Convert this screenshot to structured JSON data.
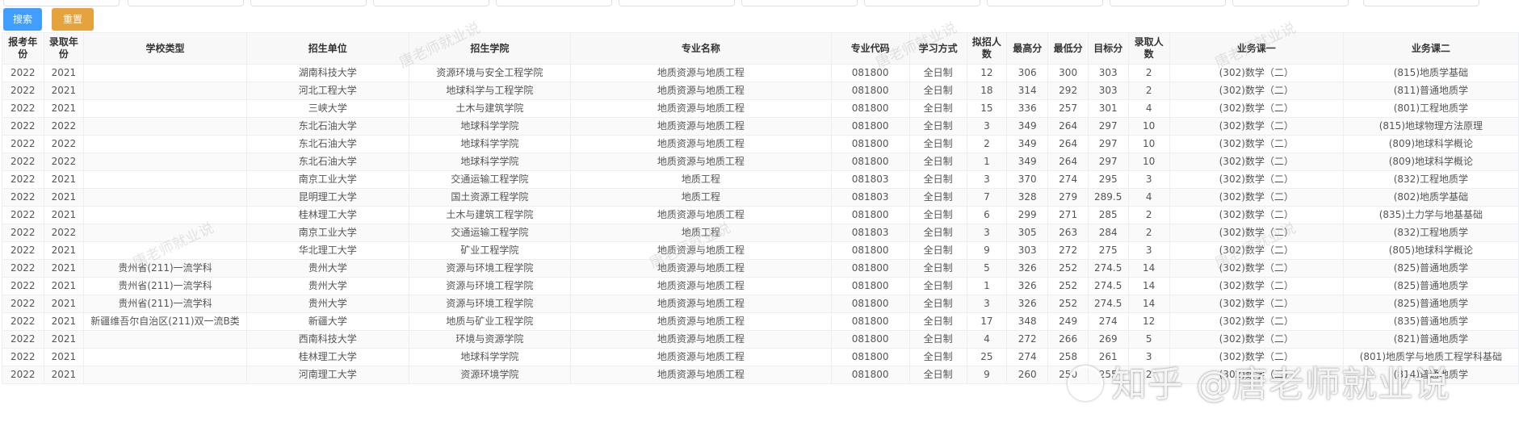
{
  "buttons": {
    "search": "搜索",
    "reset": "重置"
  },
  "columns": [
    "报考年份",
    "录取年份",
    "学校类型",
    "招生单位",
    "招生学院",
    "专业名称",
    "专业代码",
    "学习方式",
    "拟招人数",
    "最高分",
    "最低分",
    "目标分",
    "录取人数",
    "业务课一",
    "业务课二"
  ],
  "rows": [
    [
      "2022",
      "2021",
      "",
      "湖南科技大学",
      "资源环境与安全工程学院",
      "地质资源与地质工程",
      "081800",
      "全日制",
      "12",
      "306",
      "300",
      "303",
      "2",
      "(302)数学（二）",
      "(815)地质学基础"
    ],
    [
      "2022",
      "2021",
      "",
      "河北工程大学",
      "地球科学与工程学院",
      "地质资源与地质工程",
      "081800",
      "全日制",
      "18",
      "314",
      "292",
      "303",
      "2",
      "(302)数学（二）",
      "(811)普通地质学"
    ],
    [
      "2022",
      "2021",
      "",
      "三峡大学",
      "土木与建筑学院",
      "地质资源与地质工程",
      "081800",
      "全日制",
      "15",
      "336",
      "257",
      "301",
      "4",
      "(302)数学（二）",
      "(801)工程地质学"
    ],
    [
      "2022",
      "2022",
      "",
      "东北石油大学",
      "地球科学学院",
      "地质资源与地质工程",
      "081800",
      "全日制",
      "3",
      "349",
      "264",
      "297",
      "10",
      "(302)数学（二）",
      "(815)地球物理方法原理"
    ],
    [
      "2022",
      "2022",
      "",
      "东北石油大学",
      "地球科学学院",
      "地质资源与地质工程",
      "081800",
      "全日制",
      "2",
      "349",
      "264",
      "297",
      "10",
      "(302)数学（二）",
      "(809)地球科学概论"
    ],
    [
      "2022",
      "2022",
      "",
      "东北石油大学",
      "地球科学学院",
      "地质资源与地质工程",
      "081800",
      "全日制",
      "1",
      "349",
      "264",
      "297",
      "10",
      "(302)数学（二）",
      "(809)地球科学概论"
    ],
    [
      "2022",
      "2021",
      "",
      "南京工业大学",
      "交通运输工程学院",
      "地质工程",
      "081803",
      "全日制",
      "3",
      "370",
      "274",
      "295",
      "3",
      "(302)数学（二）",
      "(832)工程地质学"
    ],
    [
      "2022",
      "2021",
      "",
      "昆明理工大学",
      "国土资源工程学院",
      "地质工程",
      "081803",
      "全日制",
      "7",
      "328",
      "279",
      "289.5",
      "4",
      "(302)数学（二）",
      "(802)地质学基础"
    ],
    [
      "2022",
      "2021",
      "",
      "桂林理工大学",
      "土木与建筑工程学院",
      "地质资源与地质工程",
      "081800",
      "全日制",
      "6",
      "299",
      "271",
      "285",
      "2",
      "(302)数学（二）",
      "(835)土力学与地基基础"
    ],
    [
      "2022",
      "2022",
      "",
      "南京工业大学",
      "交通运输工程学院",
      "地质工程",
      "081803",
      "全日制",
      "3",
      "305",
      "263",
      "284",
      "2",
      "(302)数学（二）",
      "(832)工程地质学"
    ],
    [
      "2022",
      "2021",
      "",
      "华北理工大学",
      "矿业工程学院",
      "地质资源与地质工程",
      "081800",
      "全日制",
      "9",
      "303",
      "272",
      "275",
      "3",
      "(302)数学（二）",
      "(805)地球科学概论"
    ],
    [
      "2022",
      "2021",
      "贵州省(211)一流学科",
      "贵州大学",
      "资源与环境工程学院",
      "地质资源与地质工程",
      "081800",
      "全日制",
      "5",
      "326",
      "252",
      "274.5",
      "14",
      "(302)数学（二）",
      "(825)普通地质学"
    ],
    [
      "2022",
      "2021",
      "贵州省(211)一流学科",
      "贵州大学",
      "资源与环境工程学院",
      "地质资源与地质工程",
      "081800",
      "全日制",
      "1",
      "326",
      "252",
      "274.5",
      "14",
      "(302)数学（二）",
      "(825)普通地质学"
    ],
    [
      "2022",
      "2021",
      "贵州省(211)一流学科",
      "贵州大学",
      "资源与环境工程学院",
      "地质资源与地质工程",
      "081800",
      "全日制",
      "3",
      "326",
      "252",
      "274.5",
      "14",
      "(302)数学（二）",
      "(825)普通地质学"
    ],
    [
      "2022",
      "2021",
      "新疆维吾尔自治区(211)双一流B类",
      "新疆大学",
      "地质与矿业工程学院",
      "地质资源与地质工程",
      "081800",
      "全日制",
      "17",
      "348",
      "249",
      "274",
      "12",
      "(302)数学（二）",
      "(835)普通地质学"
    ],
    [
      "2022",
      "2021",
      "",
      "西南科技大学",
      "环境与资源学院",
      "地质资源与地质工程",
      "081800",
      "全日制",
      "4",
      "272",
      "266",
      "269",
      "5",
      "(302)数学（二）",
      "(821)普通地质学"
    ],
    [
      "2022",
      "2021",
      "",
      "桂林理工大学",
      "地球科学学院",
      "地质资源与地质工程",
      "081800",
      "全日制",
      "25",
      "274",
      "258",
      "261",
      "3",
      "(302)数学（二）",
      "(801)地质学与地质工程学科基础"
    ],
    [
      "2022",
      "2021",
      "",
      "河南理工大学",
      "资源环境学院",
      "地质资源与地质工程",
      "081800",
      "全日制",
      "9",
      "260",
      "250",
      "255",
      "2",
      "(302)数学（二）",
      "(814)普通地质学"
    ]
  ],
  "watermark": "唐老师就业说",
  "brand": "知乎 @唐老师就业说"
}
